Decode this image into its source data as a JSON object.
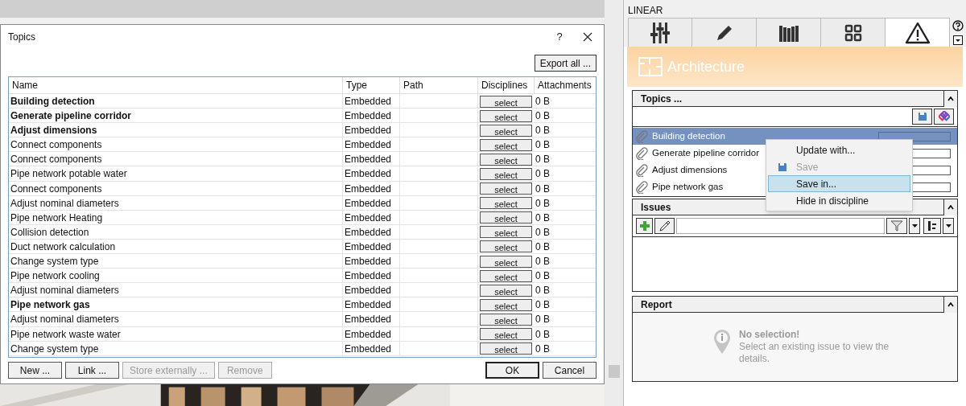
{
  "dialog": {
    "title": "Topics",
    "help": "?",
    "export_button": "Export all ...",
    "columns": [
      "Name",
      "Type",
      "Path",
      "Disciplines",
      "Attachments"
    ],
    "rows": [
      {
        "name": "Building detection",
        "bold": true,
        "type": "Embedded",
        "discipline_button": "select",
        "attachments": "0 B"
      },
      {
        "name": "Generate pipeline corridor",
        "bold": true,
        "type": "Embedded",
        "discipline_button": "select",
        "attachments": "0 B"
      },
      {
        "name": "Adjust dimensions",
        "bold": true,
        "type": "Embedded",
        "discipline_button": "select",
        "attachments": "0 B"
      },
      {
        "name": "Connect components",
        "bold": false,
        "type": "Embedded",
        "discipline_button": "select",
        "attachments": "0 B"
      },
      {
        "name": "Connect components",
        "bold": false,
        "type": "Embedded",
        "discipline_button": "select",
        "attachments": "0 B"
      },
      {
        "name": "Pipe network potable water",
        "bold": false,
        "type": "Embedded",
        "discipline_button": "select",
        "attachments": "0 B"
      },
      {
        "name": "Connect components",
        "bold": false,
        "type": "Embedded",
        "discipline_button": "select",
        "attachments": "0 B"
      },
      {
        "name": "Adjust nominal diameters",
        "bold": false,
        "type": "Embedded",
        "discipline_button": "select",
        "attachments": "0 B"
      },
      {
        "name": "Pipe network Heating",
        "bold": false,
        "type": "Embedded",
        "discipline_button": "select",
        "attachments": "0 B"
      },
      {
        "name": "Collision detection",
        "bold": false,
        "type": "Embedded",
        "discipline_button": "select",
        "attachments": "0 B"
      },
      {
        "name": "Duct network calculation",
        "bold": false,
        "type": "Embedded",
        "discipline_button": "select",
        "attachments": "0 B"
      },
      {
        "name": "Change system type",
        "bold": false,
        "type": "Embedded",
        "discipline_button": "select",
        "attachments": "0 B"
      },
      {
        "name": "Pipe network cooling",
        "bold": false,
        "type": "Embedded",
        "discipline_button": "select",
        "attachments": "0 B"
      },
      {
        "name": "Adjust nominal diameters",
        "bold": false,
        "type": "Embedded",
        "discipline_button": "select",
        "attachments": "0 B"
      },
      {
        "name": "Pipe network gas",
        "bold": true,
        "type": "Embedded",
        "discipline_button": "select",
        "attachments": "0 B"
      },
      {
        "name": "Adjust nominal diameters",
        "bold": false,
        "type": "Embedded",
        "discipline_button": "select",
        "attachments": "0 B"
      },
      {
        "name": "Pipe network waste water",
        "bold": false,
        "type": "Embedded",
        "discipline_button": "select",
        "attachments": "0 B"
      },
      {
        "name": "Change system type",
        "bold": false,
        "type": "Embedded",
        "discipline_button": "select",
        "attachments": "0 B"
      }
    ],
    "left_buttons": [
      {
        "label": "New ...",
        "disabled": false
      },
      {
        "label": "Link ...",
        "disabled": false
      },
      {
        "label": "Store externally ...",
        "disabled": true
      },
      {
        "label": "Remove",
        "disabled": true
      }
    ],
    "right_buttons": [
      {
        "label": "OK",
        "default": true
      },
      {
        "label": "Cancel",
        "default": false
      }
    ]
  },
  "panel": {
    "title": "LINEAR",
    "tabs": [
      {
        "kind": "sliders",
        "selected": false
      },
      {
        "kind": "pencil",
        "selected": false
      },
      {
        "kind": "books",
        "selected": false
      },
      {
        "kind": "grid",
        "selected": false
      },
      {
        "kind": "warning",
        "selected": true
      }
    ],
    "discipline": "Architecture",
    "topics": {
      "title": "Topics ...",
      "items": [
        {
          "name": "Building detection",
          "selected": true
        },
        {
          "name": "Generate pipeline corridor",
          "selected": false
        },
        {
          "name": "Adjust dimensions",
          "selected": false
        },
        {
          "name": "Pipe network gas",
          "selected": false
        }
      ]
    },
    "context_menu": [
      {
        "label": "Update with...",
        "disabled": false,
        "selected": false,
        "kind": "plain"
      },
      {
        "label": "Save",
        "disabled": true,
        "selected": false,
        "kind": "save"
      },
      {
        "label": "Save in...",
        "disabled": false,
        "selected": true,
        "kind": "plain"
      },
      {
        "label": "Hide in discipline",
        "disabled": false,
        "selected": false,
        "kind": "plain"
      }
    ],
    "issues": {
      "title": "Issues"
    },
    "report": {
      "title": "Report",
      "empty_title": "No selection!",
      "empty_text": "Select an existing issue to view the details."
    }
  }
}
